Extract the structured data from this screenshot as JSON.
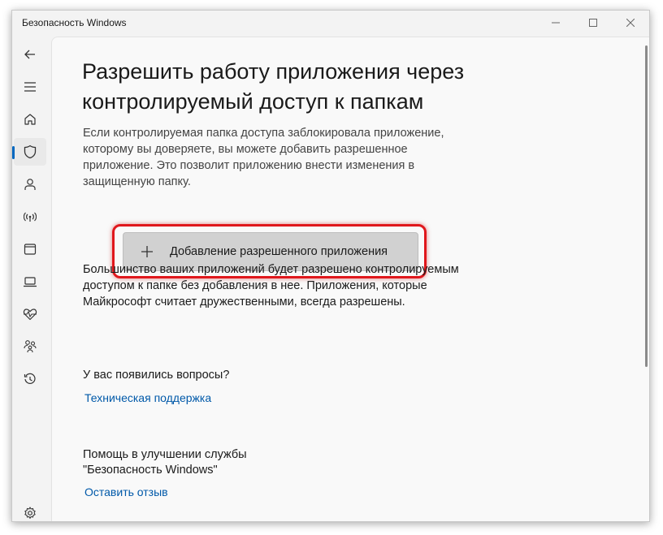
{
  "window": {
    "title": "Безопасность Windows"
  },
  "nav": {
    "items": [
      {
        "name": "back",
        "icon": "back-arrow-icon"
      },
      {
        "name": "menu",
        "icon": "hamburger-menu-icon"
      },
      {
        "name": "home",
        "icon": "home-icon"
      },
      {
        "name": "virus-protection",
        "icon": "shield-icon",
        "active": true
      },
      {
        "name": "account-protection",
        "icon": "person-icon"
      },
      {
        "name": "firewall",
        "icon": "wifi-signal-icon"
      },
      {
        "name": "app-browser-control",
        "icon": "browser-window-icon"
      },
      {
        "name": "device-security",
        "icon": "laptop-icon"
      },
      {
        "name": "device-performance",
        "icon": "heart-pulse-icon"
      },
      {
        "name": "family-options",
        "icon": "family-icon"
      },
      {
        "name": "protection-history",
        "icon": "history-icon"
      },
      {
        "name": "settings",
        "icon": "gear-icon"
      }
    ]
  },
  "main": {
    "heading": "Разрешить работу приложения через контролируемый доступ к папкам",
    "description": "Если контролируемая папка доступа заблокировала приложение, которому вы доверяете, вы можете добавить разрешенное приложение. Это позволит приложению внести изменения в защищенную папку.",
    "add_button_label": "Добавление разрешенного приложения",
    "info": "Большинство ваших приложений будет разрешено контролируемым доступом к папке без добавления в нее. Приложения, которые Майкрософт считает дружественными, всегда разрешены.",
    "questions_title": "У вас появились вопросы?",
    "support_link": "Техническая поддержка",
    "feedback_title_line1": "Помощь в улучшении службы",
    "feedback_title_line2": "\"Безопасность Windows\"",
    "feedback_link": "Оставить отзыв"
  },
  "colors": {
    "accent": "#0067c0",
    "link": "#0059a9",
    "highlight": "#e0171c"
  }
}
